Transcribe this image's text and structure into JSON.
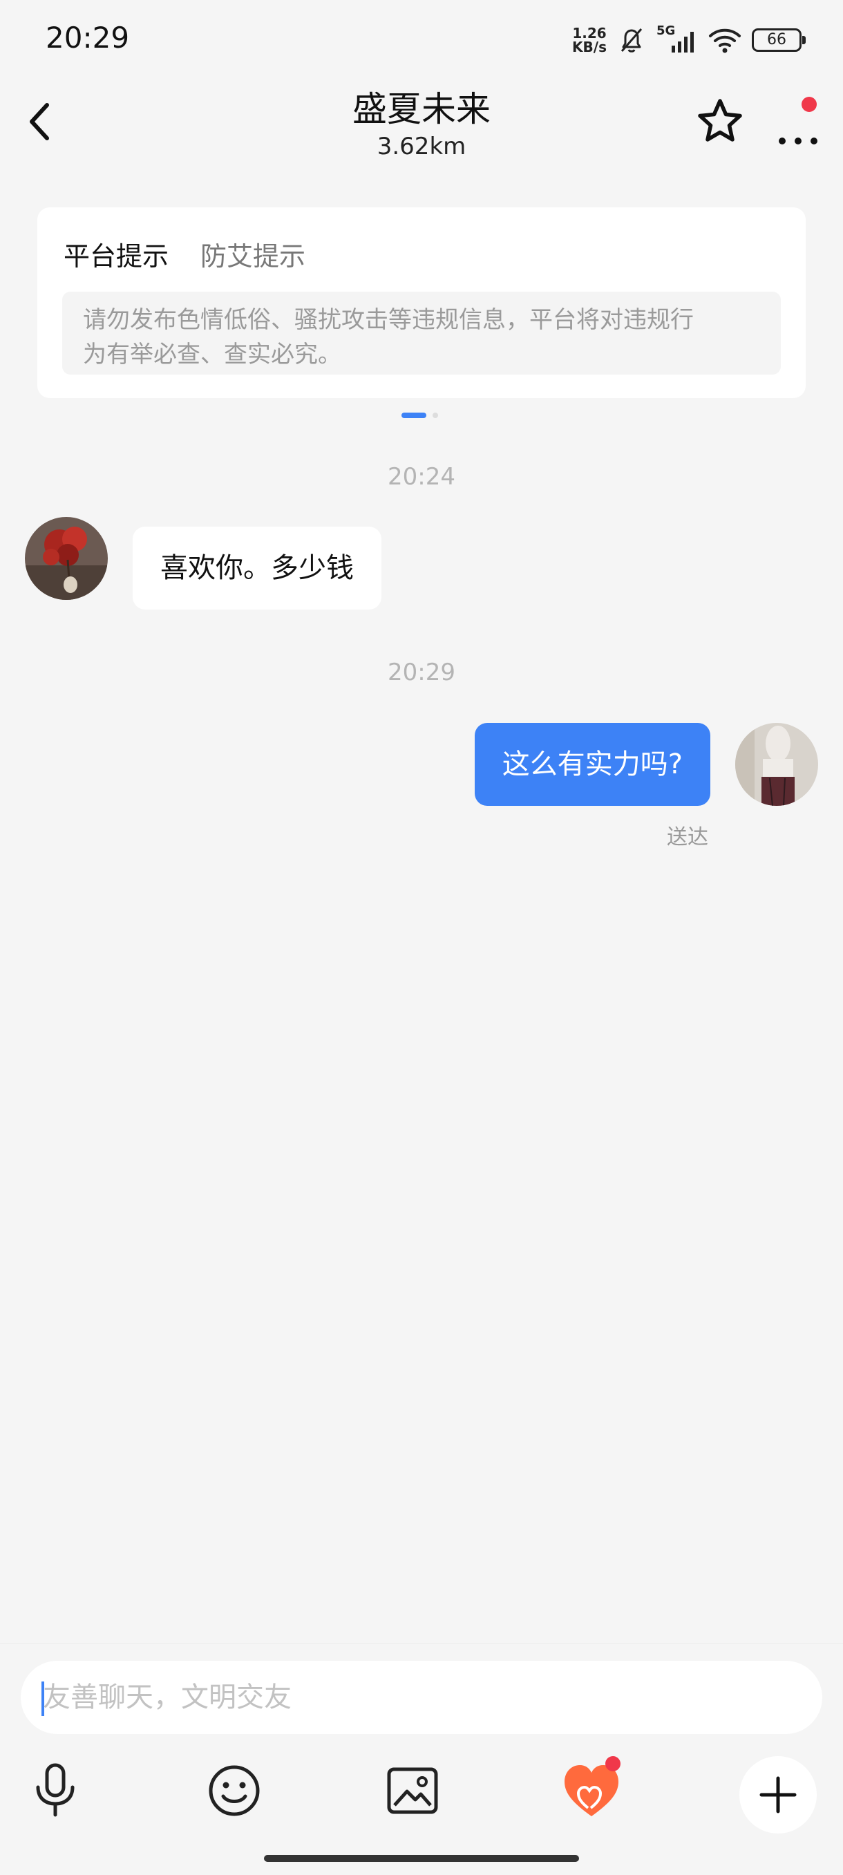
{
  "status_bar": {
    "time": "20:29",
    "net_speed_value": "1.26",
    "net_speed_unit": "KB/s",
    "network": "5G",
    "battery": "66"
  },
  "header": {
    "title": "盛夏未来",
    "distance": "3.62km"
  },
  "notice": {
    "tabs": [
      "平台提示",
      "防艾提示"
    ],
    "text_line1": "请勿发布色情低俗、骚扰攻击等违规信息，平台将对违规行",
    "text_line2": "为有举必查、查实必究。"
  },
  "messages": [
    {
      "timestamp": "20:24",
      "direction": "incoming",
      "text": "喜欢你。多少钱"
    },
    {
      "timestamp": "20:29",
      "direction": "outgoing",
      "text": "这么有实力吗?",
      "status": "送达"
    }
  ],
  "composer": {
    "placeholder": "友善聊天，文明交友"
  },
  "toolbar": {
    "icons": [
      "microphone-icon",
      "emoji-icon",
      "image-icon",
      "heart-gift-icon",
      "plus-icon"
    ]
  },
  "colors": {
    "accent": "#3d82f6",
    "badge": "#f0384a",
    "gift": "#ff6a3d",
    "background": "#f5f5f5"
  }
}
